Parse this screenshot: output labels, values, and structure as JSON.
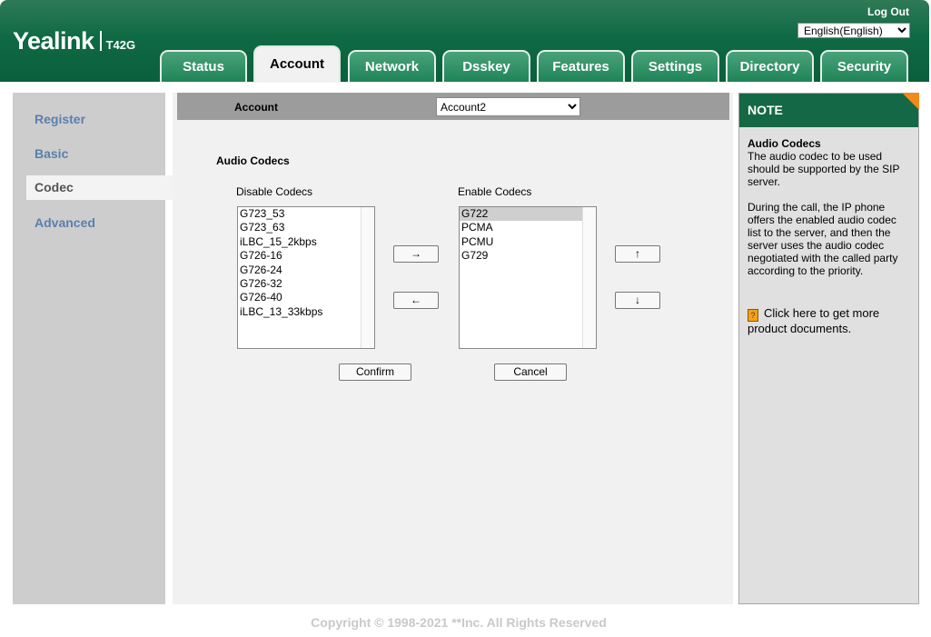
{
  "header": {
    "logo": "Yealink",
    "model": "T42G",
    "logout": "Log Out",
    "language": {
      "selected": "English(English)"
    },
    "tabs": [
      {
        "label": "Status"
      },
      {
        "label": "Account"
      },
      {
        "label": "Network"
      },
      {
        "label": "Dsskey"
      },
      {
        "label": "Features"
      },
      {
        "label": "Settings"
      },
      {
        "label": "Directory"
      },
      {
        "label": "Security"
      }
    ],
    "active_tab": "Account"
  },
  "sidebar": {
    "items": [
      {
        "label": "Register"
      },
      {
        "label": "Basic"
      },
      {
        "label": "Codec"
      },
      {
        "label": "Advanced"
      }
    ],
    "active": "Codec"
  },
  "main": {
    "account_label": "Account",
    "account_selected": "Account2",
    "section_title": "Audio Codecs",
    "disable_label": "Disable Codecs",
    "enable_label": "Enable Codecs",
    "disabled_codecs": [
      "G723_53",
      "G723_63",
      "iLBC_15_2kbps",
      "G726-16",
      "G726-24",
      "G726-32",
      "G726-40",
      "iLBC_13_33kbps"
    ],
    "enabled_codecs": [
      "G722",
      "PCMA",
      "PCMU",
      "G729"
    ],
    "selected_enabled": "G722",
    "move_right": "→",
    "move_left": "←",
    "move_up": "↑",
    "move_down": "↓",
    "confirm": "Confirm",
    "cancel": "Cancel"
  },
  "note": {
    "header": "NOTE",
    "title": "Audio Codecs",
    "paragraph1": "The audio codec to be used should be supported by the SIP server.",
    "paragraph2": "During the call, the IP phone offers the enabled audio codec list to the server, and then the server uses the audio codec negotiated with the called party according to the priority.",
    "doc_link": "Click here to get more product documents.",
    "doc_icon_glyph": "?"
  },
  "footer": {
    "copyright": "Copyright © 1998-2021 **Inc. All Rights Reserved"
  },
  "colors": {
    "header_green": "#0f6a44",
    "tab_green": "#2a8c60",
    "sidebar_link": "#5a7fae",
    "note_accent": "#f08a1c"
  }
}
